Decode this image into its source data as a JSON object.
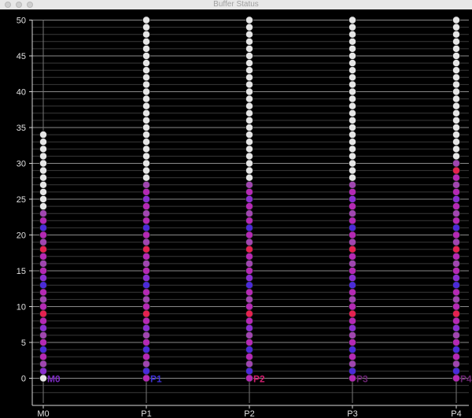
{
  "window": {
    "title": "Buffer Status"
  },
  "chart_data": {
    "type": "scatter",
    "title": "",
    "xlabel": "",
    "ylabel": "",
    "ylim": [
      0,
      50
    ],
    "y_ticks": [
      0,
      5,
      10,
      15,
      20,
      25,
      30,
      35,
      40,
      45,
      50
    ],
    "grid": true,
    "categories": [
      "M0",
      "P1",
      "P2",
      "P3",
      "P4"
    ],
    "colors": {
      "w": "#e6e6e6",
      "d": "#b429b4",
      "b": "#4a2bd8",
      "r": "#e4224f",
      "p": "#a046b0",
      "v": "#8a2fd0"
    },
    "columns": [
      {
        "name": "M0",
        "label": "M0",
        "label_color": "#7d2ac2",
        "slots": "wvpdbdpvdrdpdbvdpdrpdbdpwwwwwwwwwww"
      },
      {
        "name": "P1",
        "label": "P1",
        "label_color": "#3f30d4",
        "slots": "dbpdbdpvdrdpdbvdpdrpdbdpdvdpwwwwwwwwwwwwwwwwwwwwwwww"
      },
      {
        "name": "P2",
        "label": "P2",
        "label_color": "#d01e6e",
        "slots": "dbpdbdpvdrdpdbvdpdrpdbdpdvdpwwwwwwwwwwwwwwwwwwwwwwww"
      },
      {
        "name": "P3",
        "label": "P3",
        "label_color": "#6a2470",
        "slots": "dbpdbdpvdrdpdbvdpdrpdbdpdvdpwwwwwwwwwwwwwwwwwwwwwwww"
      },
      {
        "name": "P4",
        "label": "P4",
        "label_color": "#6a2470",
        "slots": "dbpdbdpvdrdpdbvdpdrpdbdpdvdpdrpwwwwwwwwwwwwwwwwwwwwww"
      }
    ]
  }
}
